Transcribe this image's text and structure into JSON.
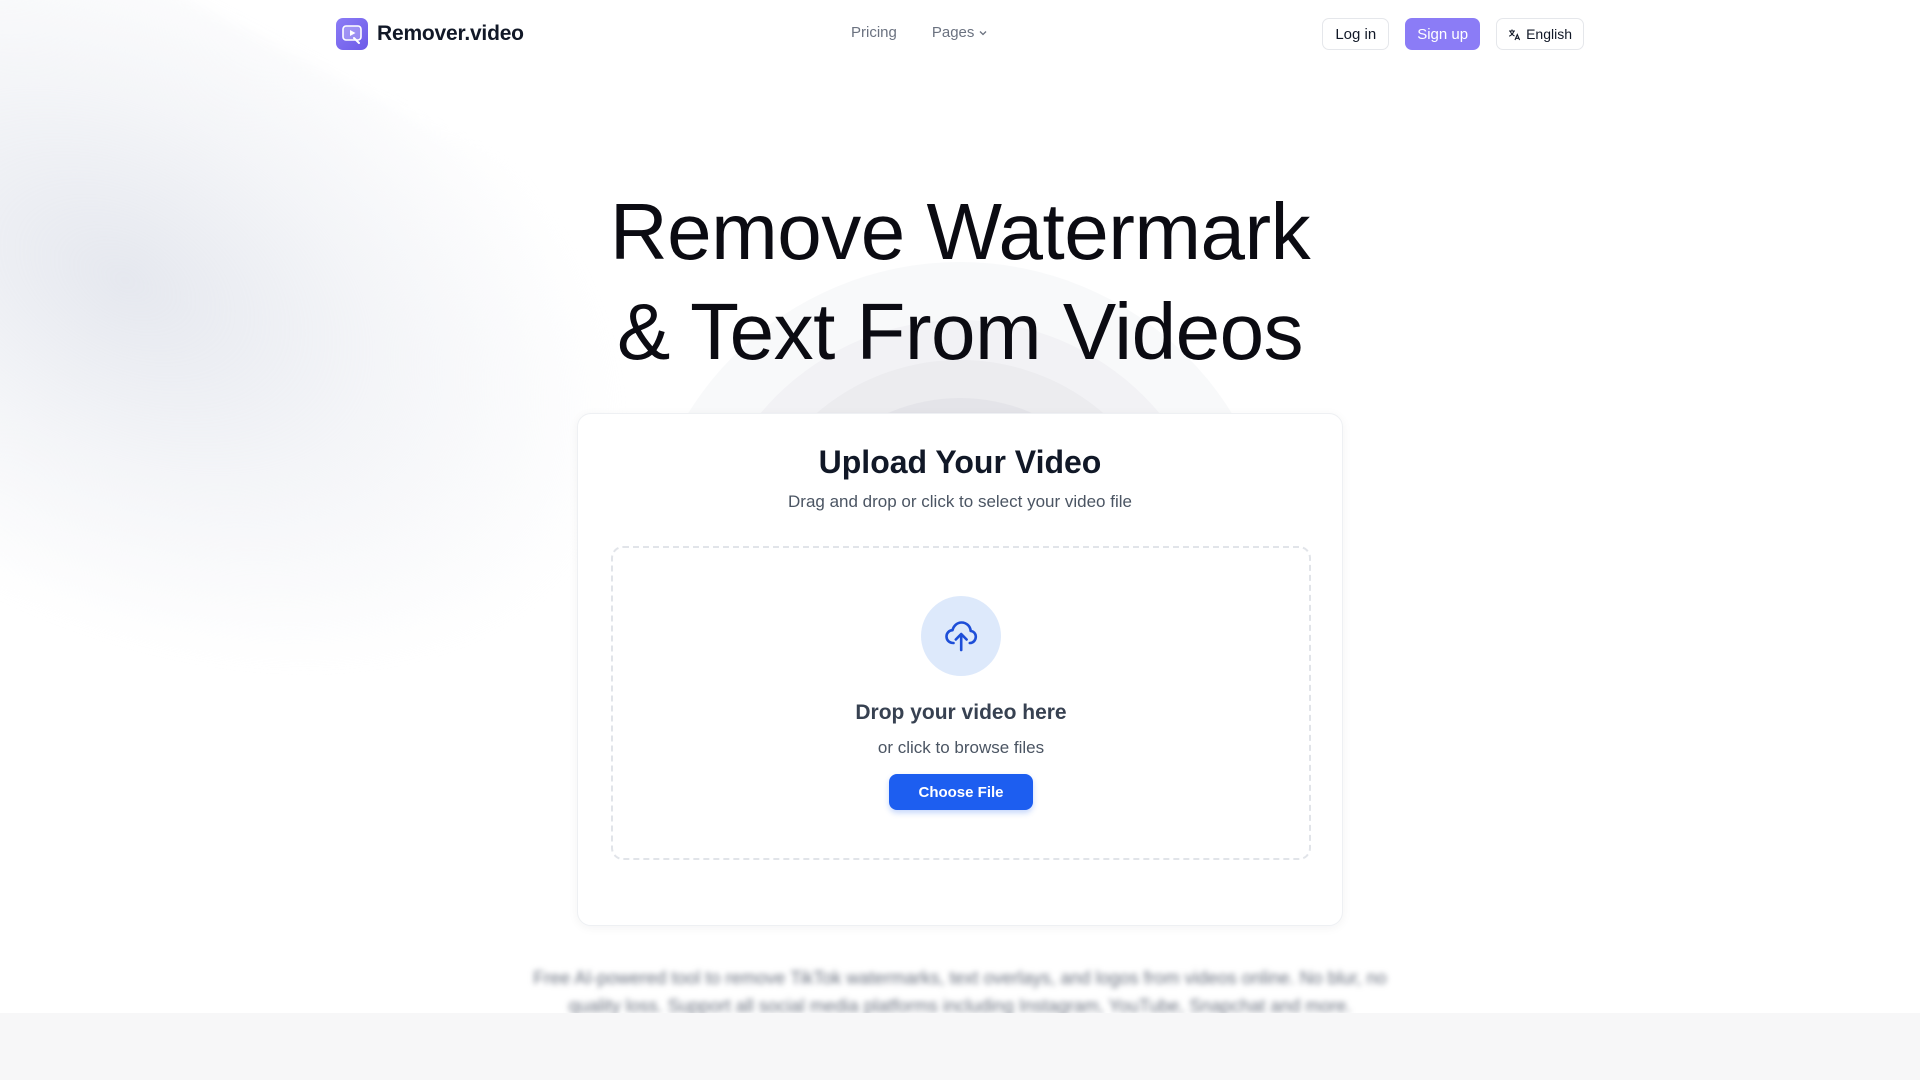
{
  "header": {
    "logo_text": "Remover.video",
    "nav": [
      {
        "label": "Pricing"
      },
      {
        "label": "Pages"
      }
    ],
    "login_label": "Log in",
    "signup_label": "Sign up",
    "language_label": "English"
  },
  "hero": {
    "title_line1": "Remove Watermark",
    "title_line2": "& Text From Videos"
  },
  "upload": {
    "title": "Upload Your Video",
    "subtitle": "Drag and drop or click to select your video file",
    "drop_title": "Drop your video here",
    "drop_subtitle": "or click to browse files",
    "choose_label": "Choose File"
  },
  "description": {
    "text": "Free AI-powered tool to remove TikTok watermarks, text overlays, and logos from videos online. No blur, no quality loss. Support all social media platforms including Instagram, YouTube, Snapchat and more."
  },
  "colors": {
    "brand": "#8b7cf6",
    "primary_button": "#1d5ef0",
    "upload_icon_bg": "#dde9fb"
  },
  "icons": {
    "logo": "video-play-icon",
    "pages_chevron": "chevron-down-icon",
    "language": "translate-icon",
    "upload": "cloud-upload-icon"
  }
}
